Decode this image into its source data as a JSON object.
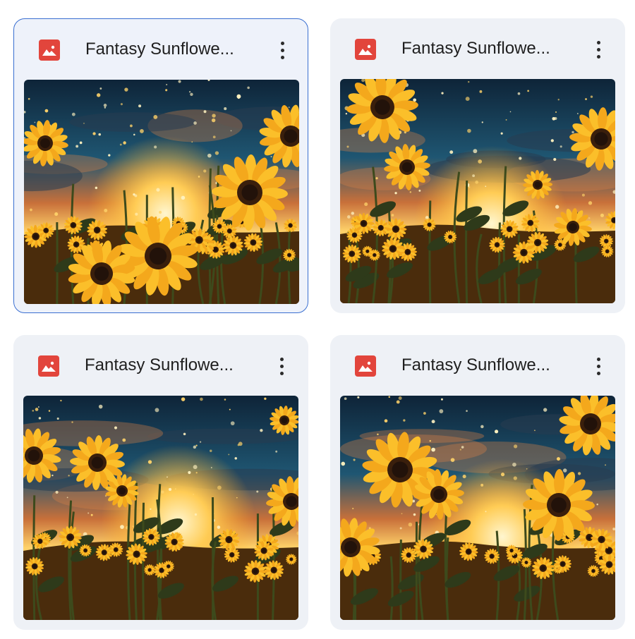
{
  "files": [
    {
      "title": "Fantasy Sunflowe...",
      "icon": "image-file-icon",
      "selected": true,
      "variant": 0
    },
    {
      "title": "Fantasy Sunflowe...",
      "icon": "image-file-icon",
      "selected": false,
      "variant": 1
    },
    {
      "title": "Fantasy Sunflowe...",
      "icon": "image-file-icon",
      "selected": false,
      "variant": 2
    },
    {
      "title": "Fantasy Sunflowe...",
      "icon": "image-file-icon",
      "selected": false,
      "variant": 3
    }
  ],
  "colors": {
    "file_icon": "#e2453c",
    "selected_border": "#3a6fd1",
    "card_bg": "#eef1f6"
  }
}
